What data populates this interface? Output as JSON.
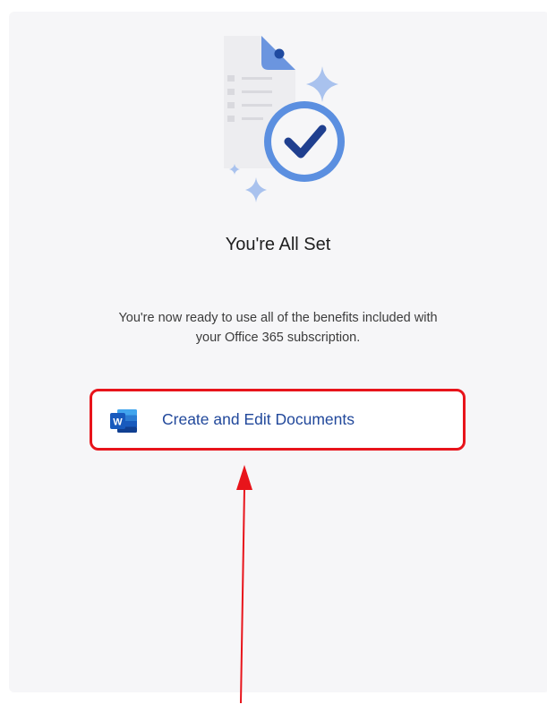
{
  "screen": {
    "title": "You're All Set",
    "description_line1": "You're now ready to use all of the benefits included with",
    "description_line2": "your Office 365 subscription."
  },
  "action": {
    "label": "Create and Edit Documents",
    "icon": "word-app-icon",
    "icon_letter": "W"
  },
  "annotation": {
    "highlight_color": "#e8141b",
    "arrow_color": "#e8141b"
  },
  "colors": {
    "accent": "#21489b",
    "check_ring": "#5b8fe0",
    "panel_bg": "#f6f6f8"
  }
}
